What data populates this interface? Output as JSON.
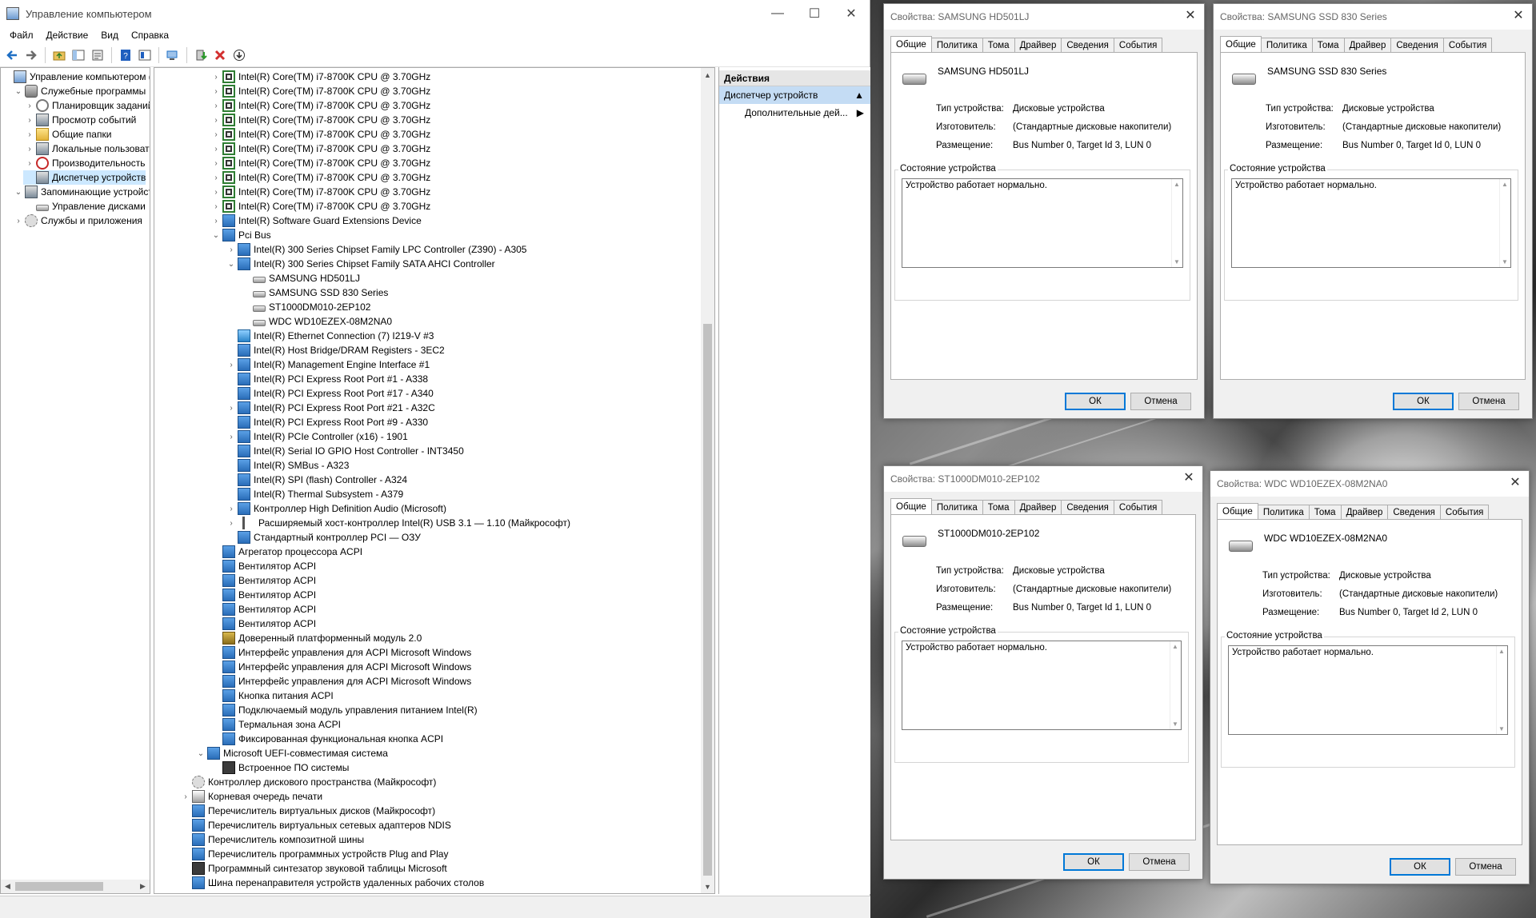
{
  "mmc": {
    "title": "Управление компьютером",
    "menu": [
      "Файл",
      "Действие",
      "Вид",
      "Справка"
    ],
    "window_buttons": {
      "minimize": "—",
      "maximize": "☐",
      "close": "✕"
    },
    "toolbar_icons": [
      "back-icon",
      "forward-icon",
      "up-folder-icon",
      "show-hide-tree-icon",
      "properties-icon",
      "help-icon",
      "help-topics-icon",
      "scan-hardware-icon",
      "update-driver-icon",
      "uninstall-icon",
      "download-icon"
    ],
    "left_tree": [
      {
        "label": "Управление компьютером (л",
        "indent": 0,
        "expander": "",
        "icon": "comp"
      },
      {
        "label": "Служебные программы",
        "indent": 1,
        "expander": "⌄",
        "icon": "tools"
      },
      {
        "label": "Планировщик заданий",
        "indent": 2,
        "expander": "›",
        "icon": "clock"
      },
      {
        "label": "Просмотр событий",
        "indent": 2,
        "expander": "›",
        "icon": "mgr"
      },
      {
        "label": "Общие папки",
        "indent": 2,
        "expander": "›",
        "icon": "folder"
      },
      {
        "label": "Локальные пользовате",
        "indent": 2,
        "expander": "›",
        "icon": "mgr"
      },
      {
        "label": "Производительность",
        "indent": 2,
        "expander": "›",
        "icon": "perf"
      },
      {
        "label": "Диспетчер устройств",
        "indent": 2,
        "expander": "",
        "icon": "mgr",
        "selected": true
      },
      {
        "label": "Запоминающие устройст",
        "indent": 1,
        "expander": "⌄",
        "icon": "mgr"
      },
      {
        "label": "Управление дисками",
        "indent": 2,
        "expander": "",
        "icon": "disk"
      },
      {
        "label": "Службы и приложения",
        "indent": 1,
        "expander": "›",
        "icon": "gear"
      }
    ],
    "device_tree": [
      {
        "label": "Intel(R) Core(TM) i7-8700K CPU @ 3.70GHz",
        "indent": 3,
        "expander": "›",
        "icon": "chip"
      },
      {
        "label": "Intel(R) Core(TM) i7-8700K CPU @ 3.70GHz",
        "indent": 3,
        "expander": "›",
        "icon": "chip"
      },
      {
        "label": "Intel(R) Core(TM) i7-8700K CPU @ 3.70GHz",
        "indent": 3,
        "expander": "›",
        "icon": "chip"
      },
      {
        "label": "Intel(R) Core(TM) i7-8700K CPU @ 3.70GHz",
        "indent": 3,
        "expander": "›",
        "icon": "chip"
      },
      {
        "label": "Intel(R) Core(TM) i7-8700K CPU @ 3.70GHz",
        "indent": 3,
        "expander": "›",
        "icon": "chip"
      },
      {
        "label": "Intel(R) Core(TM) i7-8700K CPU @ 3.70GHz",
        "indent": 3,
        "expander": "›",
        "icon": "chip"
      },
      {
        "label": "Intel(R) Core(TM) i7-8700K CPU @ 3.70GHz",
        "indent": 3,
        "expander": "›",
        "icon": "chip"
      },
      {
        "label": "Intel(R) Core(TM) i7-8700K CPU @ 3.70GHz",
        "indent": 3,
        "expander": "›",
        "icon": "chip"
      },
      {
        "label": "Intel(R) Core(TM) i7-8700K CPU @ 3.70GHz",
        "indent": 3,
        "expander": "›",
        "icon": "chip"
      },
      {
        "label": "Intel(R) Core(TM) i7-8700K CPU @ 3.70GHz",
        "indent": 3,
        "expander": "›",
        "icon": "chip"
      },
      {
        "label": "Intel(R) Software Guard Extensions Device",
        "indent": 3,
        "expander": "›",
        "icon": "dev"
      },
      {
        "label": "Pci Bus",
        "indent": 3,
        "expander": "⌄",
        "icon": "dev"
      },
      {
        "label": "Intel(R) 300 Series Chipset Family LPC Controller (Z390) - A305",
        "indent": 4,
        "expander": "›",
        "icon": "dev"
      },
      {
        "label": "Intel(R) 300 Series Chipset Family SATA AHCI Controller",
        "indent": 4,
        "expander": "⌄",
        "icon": "dev"
      },
      {
        "label": "SAMSUNG HD501LJ",
        "indent": 5,
        "expander": "",
        "icon": "disk"
      },
      {
        "label": "SAMSUNG SSD 830 Series",
        "indent": 5,
        "expander": "",
        "icon": "disk"
      },
      {
        "label": "ST1000DM010-2EP102",
        "indent": 5,
        "expander": "",
        "icon": "disk"
      },
      {
        "label": "WDC WD10EZEX-08M2NA0",
        "indent": 5,
        "expander": "",
        "icon": "disk"
      },
      {
        "label": "Intel(R) Ethernet Connection (7) I219-V #3",
        "indent": 4,
        "expander": "",
        "icon": "net"
      },
      {
        "label": "Intel(R) Host Bridge/DRAM Registers - 3EC2",
        "indent": 4,
        "expander": "",
        "icon": "dev"
      },
      {
        "label": "Intel(R) Management Engine Interface #1",
        "indent": 4,
        "expander": "›",
        "icon": "dev"
      },
      {
        "label": "Intel(R) PCI Express Root Port #1 - A338",
        "indent": 4,
        "expander": "",
        "icon": "dev"
      },
      {
        "label": "Intel(R) PCI Express Root Port #17 - A340",
        "indent": 4,
        "expander": "",
        "icon": "dev"
      },
      {
        "label": "Intel(R) PCI Express Root Port #21 - A32C",
        "indent": 4,
        "expander": "›",
        "icon": "dev"
      },
      {
        "label": "Intel(R) PCI Express Root Port #9 - A330",
        "indent": 4,
        "expander": "",
        "icon": "dev"
      },
      {
        "label": "Intel(R) PCIe Controller (x16) - 1901",
        "indent": 4,
        "expander": "›",
        "icon": "dev"
      },
      {
        "label": "Intel(R) Serial IO GPIO Host Controller - INT3450",
        "indent": 4,
        "expander": "",
        "icon": "dev"
      },
      {
        "label": "Intel(R) SMBus - A323",
        "indent": 4,
        "expander": "",
        "icon": "dev"
      },
      {
        "label": "Intel(R) SPI (flash) Controller - A324",
        "indent": 4,
        "expander": "",
        "icon": "dev"
      },
      {
        "label": "Intel(R) Thermal Subsystem - A379",
        "indent": 4,
        "expander": "",
        "icon": "dev"
      },
      {
        "label": "Контроллер High Definition Audio (Microsoft)",
        "indent": 4,
        "expander": "›",
        "icon": "dev"
      },
      {
        "label": "Расширяемый хост-контроллер Intel(R) USB 3.1 — 1.10 (Майкрософт)",
        "indent": 4,
        "expander": "›",
        "icon": "usb"
      },
      {
        "label": "Стандартный контроллер PCI — ОЗУ",
        "indent": 4,
        "expander": "",
        "icon": "dev"
      },
      {
        "label": "Агрегатор процессора ACPI",
        "indent": 3,
        "expander": "",
        "icon": "dev"
      },
      {
        "label": "Вентилятор ACPI",
        "indent": 3,
        "expander": "",
        "icon": "dev"
      },
      {
        "label": "Вентилятор ACPI",
        "indent": 3,
        "expander": "",
        "icon": "dev"
      },
      {
        "label": "Вентилятор ACPI",
        "indent": 3,
        "expander": "",
        "icon": "dev"
      },
      {
        "label": "Вентилятор ACPI",
        "indent": 3,
        "expander": "",
        "icon": "dev"
      },
      {
        "label": "Вентилятор ACPI",
        "indent": 3,
        "expander": "",
        "icon": "dev"
      },
      {
        "label": "Доверенный платформенный модуль 2.0",
        "indent": 3,
        "expander": "",
        "icon": "tpm"
      },
      {
        "label": "Интерфейс управления для ACPI Microsoft Windows",
        "indent": 3,
        "expander": "",
        "icon": "dev"
      },
      {
        "label": "Интерфейс управления для ACPI Microsoft Windows",
        "indent": 3,
        "expander": "",
        "icon": "dev"
      },
      {
        "label": "Интерфейс управления для ACPI Microsoft Windows",
        "indent": 3,
        "expander": "",
        "icon": "dev"
      },
      {
        "label": "Кнопка питания ACPI",
        "indent": 3,
        "expander": "",
        "icon": "dev"
      },
      {
        "label": "Подключаемый модуль управления питанием Intel(R)",
        "indent": 3,
        "expander": "",
        "icon": "dev"
      },
      {
        "label": "Термальная зона ACPI",
        "indent": 3,
        "expander": "",
        "icon": "dev"
      },
      {
        "label": "Фиксированная функциональная кнопка ACPI",
        "indent": 3,
        "expander": "",
        "icon": "dev"
      },
      {
        "label": "Microsoft UEFI-совместимая система",
        "indent": 2,
        "expander": "⌄",
        "icon": "dev"
      },
      {
        "label": "Встроенное ПО системы",
        "indent": 3,
        "expander": "",
        "icon": "fw"
      },
      {
        "label": "Контроллер дискового пространства (Майкрософт)",
        "indent": 1,
        "expander": "",
        "icon": "gear"
      },
      {
        "label": "Корневая очередь печати",
        "indent": 1,
        "expander": "›",
        "icon": "print"
      },
      {
        "label": "Перечислитель виртуальных дисков (Майкрософт)",
        "indent": 1,
        "expander": "",
        "icon": "dev"
      },
      {
        "label": "Перечислитель виртуальных сетевых адаптеров NDIS",
        "indent": 1,
        "expander": "",
        "icon": "dev"
      },
      {
        "label": "Перечислитель композитной шины",
        "indent": 1,
        "expander": "",
        "icon": "dev"
      },
      {
        "label": "Перечислитель программных устройств Plug and Play",
        "indent": 1,
        "expander": "",
        "icon": "dev"
      },
      {
        "label": "Программный синтезатор звуковой таблицы Microsoft",
        "indent": 1,
        "expander": "",
        "icon": "fw"
      },
      {
        "label": "Шина перенаправителя устройств удаленных рабочих столов",
        "indent": 1,
        "expander": "",
        "icon": "dev"
      }
    ],
    "actions": {
      "header": "Действия",
      "item": "Диспетчер устройств",
      "sub": "Дополнительные дей..."
    }
  },
  "dialogs": [
    {
      "title": "Свойства: SAMSUNG HD501LJ",
      "tabs": [
        "Общие",
        "Политика",
        "Тома",
        "Драйвер",
        "Сведения",
        "События"
      ],
      "device_name": "SAMSUNG HD501LJ",
      "props": [
        {
          "k": "Тип устройства:",
          "v": "Дисковые устройства"
        },
        {
          "k": "Изготовитель:",
          "v": "(Стандартные дисковые накопители)"
        },
        {
          "k": "Размещение:",
          "v": "Bus Number 0, Target Id 3, LUN 0"
        }
      ],
      "status_label": "Состояние устройства",
      "status_text": "Устройство работает нормально.",
      "ok": "ОК",
      "cancel": "Отмена"
    },
    {
      "title": "Свойства: SAMSUNG SSD 830 Series",
      "tabs": [
        "Общие",
        "Политика",
        "Тома",
        "Драйвер",
        "Сведения",
        "События"
      ],
      "device_name": "SAMSUNG SSD 830 Series",
      "props": [
        {
          "k": "Тип устройства:",
          "v": "Дисковые устройства"
        },
        {
          "k": "Изготовитель:",
          "v": "(Стандартные дисковые накопители)"
        },
        {
          "k": "Размещение:",
          "v": "Bus Number 0, Target Id 0, LUN 0"
        }
      ],
      "status_label": "Состояние устройства",
      "status_text": "Устройство работает нормально.",
      "ok": "ОК",
      "cancel": "Отмена"
    },
    {
      "title": "Свойства: ST1000DM010-2EP102",
      "tabs": [
        "Общие",
        "Политика",
        "Тома",
        "Драйвер",
        "Сведения",
        "События"
      ],
      "device_name": "ST1000DM010-2EP102",
      "props": [
        {
          "k": "Тип устройства:",
          "v": "Дисковые устройства"
        },
        {
          "k": "Изготовитель:",
          "v": "(Стандартные дисковые накопители)"
        },
        {
          "k": "Размещение:",
          "v": "Bus Number 0, Target Id 1, LUN 0"
        }
      ],
      "status_label": "Состояние устройства",
      "status_text": "Устройство работает нормально.",
      "ok": "ОК",
      "cancel": "Отмена"
    },
    {
      "title": "Свойства: WDC WD10EZEX-08M2NA0",
      "tabs": [
        "Общие",
        "Политика",
        "Тома",
        "Драйвер",
        "Сведения",
        "События"
      ],
      "device_name": "WDC WD10EZEX-08M2NA0",
      "props": [
        {
          "k": "Тип устройства:",
          "v": "Дисковые устройства"
        },
        {
          "k": "Изготовитель:",
          "v": "(Стандартные дисковые накопители)"
        },
        {
          "k": "Размещение:",
          "v": "Bus Number 0, Target Id 2, LUN 0"
        }
      ],
      "status_label": "Состояние устройства",
      "status_text": "Устройство работает нормально.",
      "ok": "ОК",
      "cancel": "Отмена"
    }
  ]
}
